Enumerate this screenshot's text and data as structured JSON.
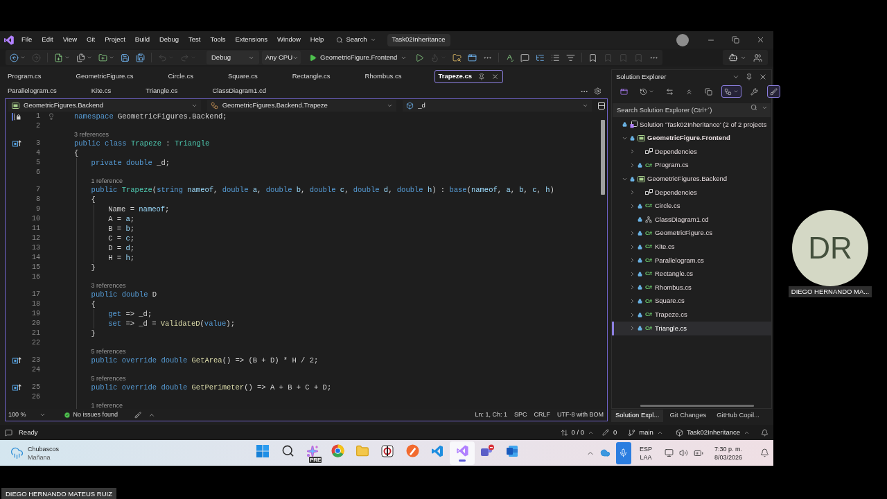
{
  "title_bar": {
    "menus": [
      "File",
      "Edit",
      "View",
      "Git",
      "Project",
      "Build",
      "Debug",
      "Test",
      "Tools",
      "Extensions",
      "Window",
      "Help"
    ],
    "search": "Search",
    "solution_name": "Task02Inheritance"
  },
  "toolbar": {
    "left_buttons": [
      {
        "disabled": false
      },
      {
        "disabled": true
      },
      {
        "disabled": false
      },
      {
        "disabled": false
      },
      {
        "disabled": false
      },
      {
        "disabled": false
      },
      {
        "disabled": false
      },
      {
        "disabled": true
      },
      {
        "disabled": true
      }
    ],
    "configuration": "Debug",
    "platform": "Any CPU",
    "startup_project": "GeometricFigure.Frontend",
    "right_buttons": [
      {
        "disabled": false
      },
      {
        "disabled": true
      },
      {
        "disabled": false
      },
      {
        "disabled": false
      },
      {
        "disabled": false
      },
      {
        "disabled": false
      },
      {
        "disabled": false
      },
      {
        "disabled": false
      },
      {
        "disabled": false
      },
      {
        "disabled": false
      },
      {
        "disabled": false
      },
      {
        "disabled": true
      },
      {
        "disabled": true
      },
      {
        "disabled": true
      },
      {
        "disabled": false
      }
    ]
  },
  "tab_rows": [
    {
      "tabs": [
        {
          "label": "Program.cs",
          "selected": false
        },
        {
          "label": "GeometricFigure.cs",
          "selected": false
        },
        {
          "label": "Circle.cs",
          "selected": false
        },
        {
          "label": "Square.cs",
          "selected": false
        },
        {
          "label": "Rectangle.cs",
          "selected": false
        },
        {
          "label": "Rhombus.cs",
          "selected": false
        },
        {
          "label": "Trapeze.cs",
          "selected": true
        }
      ]
    },
    {
      "tabs": [
        {
          "label": "Parallelogram.cs",
          "selected": false
        },
        {
          "label": "Kite.cs",
          "selected": false
        },
        {
          "label": "Triangle.cs",
          "selected": false
        },
        {
          "label": "ClassDiagram1.cd",
          "selected": false
        }
      ]
    }
  ],
  "editor": {
    "navigation": [
      {
        "kind": "project",
        "label": "GeometricFigures.Backend"
      },
      {
        "kind": "class",
        "label": "GeometricFigures.Backend.Trapeze"
      },
      {
        "kind": "field",
        "label": "_d"
      }
    ],
    "lines": [
      {
        "number": "1",
        "glyphs": [
          {
            "kind": "lock"
          },
          {
            "kind": "lightbulb"
          }
        ],
        "tokens": [
          {
            "text": "namespace ",
            "kind": "kw"
          },
          {
            "text": "GeometricFigures.Backend;",
            "kind": "plain"
          }
        ]
      },
      {
        "number": "2"
      },
      {
        "number": "3",
        "lens": "3 references",
        "glyphs": [
          {
            "kind": "override"
          }
        ],
        "tokens": [
          {
            "text": "public class ",
            "kind": "kw"
          },
          {
            "text": "Trapeze",
            "kind": "type"
          },
          {
            "text": " : ",
            "kind": "plain"
          },
          {
            "text": "Triangle",
            "kind": "type"
          }
        ]
      },
      {
        "number": "4",
        "tokens": [
          {
            "text": "{",
            "kind": "plain"
          }
        ],
        "children": [
          {
            "number": "5",
            "tokens": [
              {
                "text": "private double ",
                "kind": "kw"
              },
              {
                "text": "_d;",
                "kind": "plain"
              }
            ]
          },
          {
            "number": "6"
          },
          {
            "number": "7",
            "lens": "1 reference",
            "tokens": [
              {
                "text": "public ",
                "kind": "kw"
              },
              {
                "text": "Trapeze",
                "kind": "type"
              },
              {
                "text": "(",
                "kind": "plain"
              },
              {
                "text": "string ",
                "kind": "kw"
              },
              {
                "text": "nameof",
                "kind": "param"
              },
              {
                "text": ", ",
                "kind": "plain"
              },
              {
                "text": "double ",
                "kind": "kw"
              },
              {
                "text": "a",
                "kind": "param"
              },
              {
                "text": ", ",
                "kind": "plain"
              },
              {
                "text": "double ",
                "kind": "kw"
              },
              {
                "text": "b",
                "kind": "param"
              },
              {
                "text": ", ",
                "kind": "plain"
              },
              {
                "text": "double ",
                "kind": "kw"
              },
              {
                "text": "c",
                "kind": "param"
              },
              {
                "text": ", ",
                "kind": "plain"
              },
              {
                "text": "double ",
                "kind": "kw"
              },
              {
                "text": "d",
                "kind": "param"
              },
              {
                "text": ", ",
                "kind": "plain"
              },
              {
                "text": "double ",
                "kind": "kw"
              },
              {
                "text": "h",
                "kind": "param"
              },
              {
                "text": ") : ",
                "kind": "plain"
              },
              {
                "text": "base",
                "kind": "kw"
              },
              {
                "text": "(",
                "kind": "plain"
              },
              {
                "text": "nameof",
                "kind": "param"
              },
              {
                "text": ", ",
                "kind": "plain"
              },
              {
                "text": "a",
                "kind": "param"
              },
              {
                "text": ", ",
                "kind": "plain"
              },
              {
                "text": "b",
                "kind": "param"
              },
              {
                "text": ", ",
                "kind": "plain"
              },
              {
                "text": "c",
                "kind": "param"
              },
              {
                "text": ", ",
                "kind": "plain"
              },
              {
                "text": "h",
                "kind": "param"
              },
              {
                "text": ")",
                "kind": "plain"
              }
            ]
          },
          {
            "number": "8",
            "tokens": [
              {
                "text": "{",
                "kind": "plain"
              }
            ],
            "children": [
              {
                "number": "9",
                "tokens": [
                  {
                    "text": "Name = ",
                    "kind": "plain"
                  },
                  {
                    "text": "nameof",
                    "kind": "param"
                  },
                  {
                    "text": ";",
                    "kind": "plain"
                  }
                ]
              },
              {
                "number": "10",
                "tokens": [
                  {
                    "text": "A = ",
                    "kind": "plain"
                  },
                  {
                    "text": "a",
                    "kind": "param"
                  },
                  {
                    "text": ";",
                    "kind": "plain"
                  }
                ]
              },
              {
                "number": "11",
                "tokens": [
                  {
                    "text": "B = ",
                    "kind": "plain"
                  },
                  {
                    "text": "b",
                    "kind": "param"
                  },
                  {
                    "text": ";",
                    "kind": "plain"
                  }
                ]
              },
              {
                "number": "12",
                "tokens": [
                  {
                    "text": "C = ",
                    "kind": "plain"
                  },
                  {
                    "text": "c",
                    "kind": "param"
                  },
                  {
                    "text": ";",
                    "kind": "plain"
                  }
                ]
              },
              {
                "number": "13",
                "tokens": [
                  {
                    "text": "D = ",
                    "kind": "plain"
                  },
                  {
                    "text": "d",
                    "kind": "param"
                  },
                  {
                    "text": ";",
                    "kind": "plain"
                  }
                ]
              },
              {
                "number": "14",
                "tokens": [
                  {
                    "text": "H = ",
                    "kind": "plain"
                  },
                  {
                    "text": "h",
                    "kind": "param"
                  },
                  {
                    "text": ";",
                    "kind": "plain"
                  }
                ]
              }
            ]
          },
          {
            "number": "15",
            "tokens": [
              {
                "text": "}",
                "kind": "plain"
              }
            ]
          },
          {
            "number": "16"
          },
          {
            "number": "17",
            "lens": "3 references",
            "tokens": [
              {
                "text": "public double ",
                "kind": "kw"
              },
              {
                "text": "D",
                "kind": "plain"
              }
            ]
          },
          {
            "number": "18",
            "tokens": [
              {
                "text": "{",
                "kind": "plain"
              }
            ],
            "children": [
              {
                "number": "19",
                "tokens": [
                  {
                    "text": "get",
                    "kind": "kw"
                  },
                  {
                    "text": " => _d;",
                    "kind": "plain"
                  }
                ]
              },
              {
                "number": "20",
                "tokens": [
                  {
                    "text": "set",
                    "kind": "kw"
                  },
                  {
                    "text": " => _d = ",
                    "kind": "plain"
                  },
                  {
                    "text": "ValidateD",
                    "kind": "fn"
                  },
                  {
                    "text": "(",
                    "kind": "plain"
                  },
                  {
                    "text": "value",
                    "kind": "kw"
                  },
                  {
                    "text": ");",
                    "kind": "plain"
                  }
                ]
              }
            ]
          },
          {
            "number": "21",
            "tokens": [
              {
                "text": "}",
                "kind": "plain"
              }
            ]
          },
          {
            "number": "22"
          },
          {
            "number": "23",
            "lens": "5 references",
            "glyphs": [
              {
                "kind": "override"
              }
            ],
            "tokens": [
              {
                "text": "public override double ",
                "kind": "kw"
              },
              {
                "text": "GetArea",
                "kind": "fn"
              },
              {
                "text": "() => (B + D) * H / 2;",
                "kind": "plain"
              }
            ]
          },
          {
            "number": "24"
          },
          {
            "number": "25",
            "lens": "5 references",
            "glyphs": [
              {
                "kind": "override"
              }
            ],
            "tokens": [
              {
                "text": "public override double ",
                "kind": "kw"
              },
              {
                "text": "GetPerimeter",
                "kind": "fn"
              },
              {
                "text": "() => A + B + C + D;",
                "kind": "plain"
              }
            ]
          },
          {
            "number": "26"
          },
          {
            "lens": "1 reference"
          }
        ]
      }
    ],
    "status": {
      "zoom": "100 %",
      "issues": "No issues found",
      "position": "Ln: 1, Ch: 1",
      "indentation": "SPC",
      "line_endings": "CRLF",
      "encoding": "UTF-8 with BOM"
    }
  },
  "solution_explorer": {
    "title": "Solution Explorer",
    "toolbar_buttons": [
      {
        "on": false
      },
      {
        "on": false
      },
      {
        "on": false
      },
      {
        "on": false
      },
      {
        "on": false
      },
      {
        "on": true
      },
      {
        "on": false
      },
      {
        "on": true
      }
    ],
    "search": {
      "placeholder": "Search Solution Explorer (Ctrl+´)"
    },
    "tree": [
      {
        "kind": "solution",
        "label": "Solution 'Task02Inheritance' (2 of 2 projects",
        "locked": true,
        "selected": false,
        "children": [
          {
            "kind": "project",
            "label": "GeometricFigure.Frontend",
            "locked": true,
            "startup": true,
            "expanded": true,
            "selected": false,
            "children": [
              {
                "kind": "dependencies",
                "label": "Dependencies",
                "locked": false,
                "expanded": false,
                "selected": false
              },
              {
                "kind": "csharp",
                "type_label": "C#",
                "label": "Program.cs",
                "locked": true,
                "expanded": false,
                "selected": false
              }
            ]
          },
          {
            "kind": "project",
            "label": "GeometricFigures.Backend",
            "locked": true,
            "startup": false,
            "expanded": true,
            "selected": false,
            "children": [
              {
                "kind": "dependencies",
                "label": "Dependencies",
                "locked": false,
                "expanded": false,
                "selected": false
              },
              {
                "kind": "csharp",
                "type_label": "C#",
                "label": "Circle.cs",
                "locked": true,
                "expanded": false,
                "selected": false
              },
              {
                "kind": "diagram",
                "label": "ClassDiagram1.cd",
                "locked": true,
                "selected": false
              },
              {
                "kind": "csharp",
                "type_label": "C#",
                "label": "GeometricFigure.cs",
                "locked": true,
                "expanded": false,
                "selected": false
              },
              {
                "kind": "csharp",
                "type_label": "C#",
                "label": "Kite.cs",
                "locked": true,
                "expanded": false,
                "selected": false
              },
              {
                "kind": "csharp",
                "type_label": "C#",
                "label": "Parallelogram.cs",
                "locked": true,
                "expanded": false,
                "selected": false
              },
              {
                "kind": "csharp",
                "type_label": "C#",
                "label": "Rectangle.cs",
                "locked": true,
                "expanded": false,
                "selected": false
              },
              {
                "kind": "csharp",
                "type_label": "C#",
                "label": "Rhombus.cs",
                "locked": true,
                "expanded": false,
                "selected": false
              },
              {
                "kind": "csharp",
                "type_label": "C#",
                "label": "Square.cs",
                "locked": true,
                "expanded": false,
                "selected": false
              },
              {
                "kind": "csharp",
                "type_label": "C#",
                "label": "Trapeze.cs",
                "locked": true,
                "expanded": false,
                "selected": false
              },
              {
                "kind": "csharp",
                "type_label": "C#",
                "label": "Triangle.cs",
                "locked": true,
                "expanded": false,
                "selected": true
              }
            ]
          }
        ]
      }
    ],
    "bottom_tabs": [
      {
        "label": "Solution Expl...",
        "selected": true
      },
      {
        "label": "Git Changes",
        "selected": false
      },
      {
        "label": "GitHub Copil...",
        "selected": false
      }
    ]
  },
  "status_bar": {
    "status": "Ready",
    "sync": "0 / 0",
    "edits": "0",
    "branch": "main",
    "repository": "Task02Inheritance"
  },
  "taskbar": {
    "weather": {
      "condition": "Chubascos",
      "day": "Mañana"
    },
    "apps": [
      {
        "active": false
      },
      {
        "active": false
      },
      {
        "active": false,
        "badge": "PRE"
      },
      {
        "active": false
      },
      {
        "active": false
      },
      {
        "active": false
      },
      {
        "active": false
      },
      {
        "active": false
      },
      {
        "active": true
      },
      {
        "active": false
      },
      {
        "active": false
      }
    ],
    "tray": {
      "mic_on": true,
      "language": "ESP",
      "keyboard": "LAA",
      "time": "7:30 p. m.",
      "date": "8/03/2026"
    }
  },
  "call": {
    "participant": {
      "initials": "DR",
      "name": "DIEGO HERNANDO MA..."
    },
    "presenter": "DIEGO HERNANDO MATEUS RUIZ"
  }
}
